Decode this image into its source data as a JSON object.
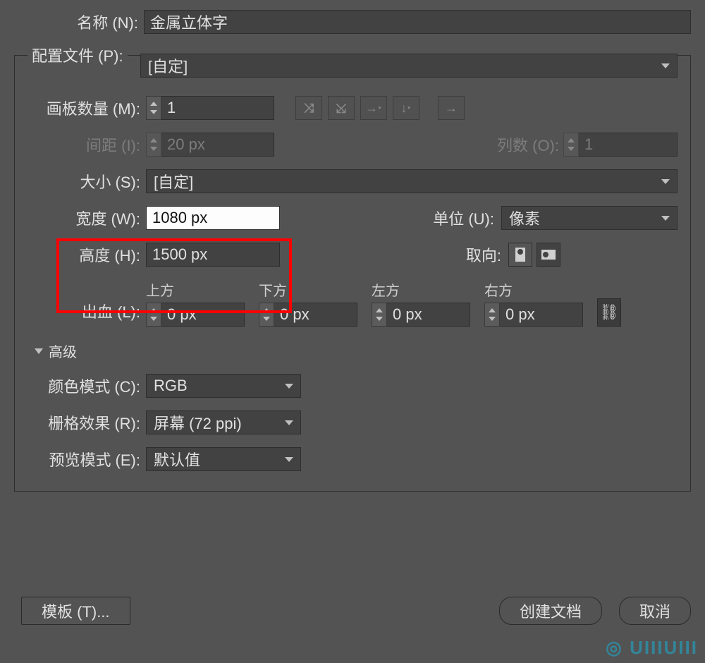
{
  "name": {
    "label": "名称 (N):",
    "value": "金属立体字"
  },
  "profile": {
    "label": "配置文件 (P):",
    "value": "[自定]"
  },
  "artboards": {
    "label": "画板数量 (M):",
    "value": "1",
    "spacing_label": "间距 (I):",
    "spacing_value": "20 px",
    "columns_label": "列数 (O):",
    "columns_value": "1"
  },
  "size": {
    "label": "大小 (S):",
    "value": "[自定]"
  },
  "width": {
    "label": "宽度 (W):",
    "value": "1080 px"
  },
  "height": {
    "label": "高度 (H):",
    "value": "1500 px"
  },
  "units": {
    "label": "单位 (U):",
    "value": "像素"
  },
  "orientation": {
    "label": "取向:"
  },
  "bleed": {
    "label": "出血 (L):",
    "top_label": "上方",
    "bottom_label": "下方",
    "left_label": "左方",
    "right_label": "右方",
    "top": "0 px",
    "bottom": "0 px",
    "left": "0 px",
    "right": "0 px"
  },
  "advanced": {
    "label": "高级"
  },
  "color_mode": {
    "label": "颜色模式 (C):",
    "value": "RGB"
  },
  "raster": {
    "label": "栅格效果 (R):",
    "value": "屏幕 (72 ppi)"
  },
  "preview": {
    "label": "预览模式 (E):",
    "value": "默认值"
  },
  "buttons": {
    "template": "模板 (T)...",
    "create": "创建文档",
    "cancel": "取消"
  },
  "watermark": "UIIIUIII"
}
